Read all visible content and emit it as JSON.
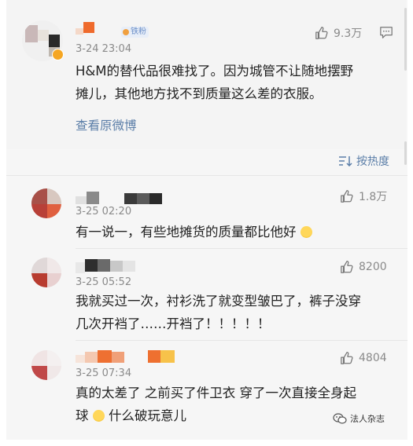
{
  "post": {
    "time": "3-24 23:04",
    "text_line1": "H&M的替代品很难找了。因为城管不让随地摆野",
    "text_line2": "摊儿，其他地方找不到质量这么差的衣服。",
    "likes": "9.3万",
    "view_original": "查看原微博",
    "badge": "铁粉",
    "like_icon": "thumbs-up-icon",
    "comment_icon": "comment-icon"
  },
  "sort": {
    "label": "按热度",
    "icon": "sort-icon"
  },
  "comments": [
    {
      "time": "3-25 02:20",
      "text": "有一说一，有些地摊货的质量都比他好",
      "likes": "1.8万",
      "emoji": "laughing-tears-emoji"
    },
    {
      "time": "3-25 05:52",
      "text_line1": "我就买过一次，衬衫洗了就变型皱巴了，裤子没穿",
      "text_line2": "几次开裆了……开裆了！！！！！",
      "likes": "8200"
    },
    {
      "time": "3-25 07:34",
      "text_line1": "真的太差了 之前买了件卫衣 穿了一次直接全身起",
      "text_line2_a": "球",
      "text_line2_b": "什么破玩意儿",
      "likes": "4804",
      "emoji": "grimace-emoji"
    }
  ],
  "watermark": {
    "text": "法人杂志",
    "icon": "wechat-icon"
  },
  "colors": {
    "link": "#5b7ea8",
    "meta": "#8a8a8a",
    "text": "#222222"
  }
}
